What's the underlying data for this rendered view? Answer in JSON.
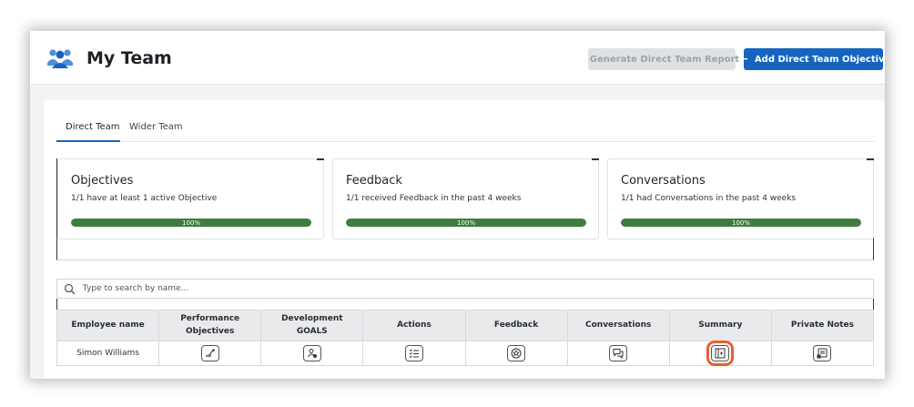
{
  "header": {
    "title": "My Team",
    "generate_report_label": "Generate Direct Team Report",
    "add_objective_label": "Add Direct Team Objective"
  },
  "tabs": [
    {
      "label": "Direct Team",
      "active": true
    },
    {
      "label": "Wider Team",
      "active": false
    }
  ],
  "stats": [
    {
      "title": "Objectives",
      "description": "1/1 have at least 1 active Objective",
      "progress": 100,
      "progress_label": "100%"
    },
    {
      "title": "Feedback",
      "description": "1/1 received Feedback in the past 4 weeks",
      "progress": 100,
      "progress_label": "100%"
    },
    {
      "title": "Conversations",
      "description": "1/1 had Conversations in the past 4 weeks",
      "progress": 100,
      "progress_label": "100%"
    }
  ],
  "search": {
    "placeholder": "Type to search by name..."
  },
  "table": {
    "columns": [
      {
        "line1": "Employee name",
        "line2": ""
      },
      {
        "line1": "Performance",
        "line2": "Objectives"
      },
      {
        "line1": "Development",
        "line2": "GOALS"
      },
      {
        "line1": "Actions",
        "line2": ""
      },
      {
        "line1": "Feedback",
        "line2": ""
      },
      {
        "line1": "Conversations",
        "line2": ""
      },
      {
        "line1": "Summary",
        "line2": ""
      },
      {
        "line1": "Private Notes",
        "line2": ""
      }
    ],
    "rows": [
      {
        "employee_name": "Simon Williams"
      }
    ]
  },
  "colors": {
    "primary": "#1565c0",
    "progress": "#3e7d3e",
    "highlight": "#e8602c"
  }
}
